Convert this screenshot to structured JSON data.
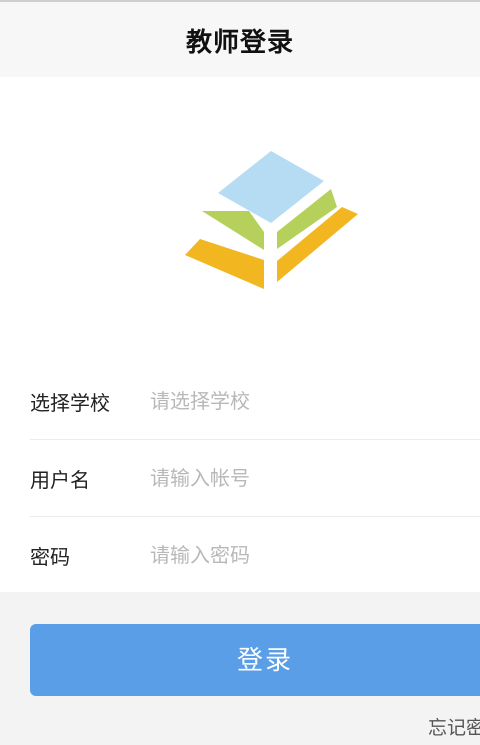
{
  "header": {
    "title": "教师登录"
  },
  "logo": {
    "name": "pyramid-logo",
    "colors": {
      "top": "#b6dcf3",
      "middle": "#b5d15b",
      "bottom": "#f2b720"
    }
  },
  "form": {
    "school": {
      "label": "选择学校",
      "placeholder": "请选择学校",
      "value": ""
    },
    "username": {
      "label": "用户名",
      "placeholder": "请输入帐号",
      "value": ""
    },
    "password": {
      "label": "密码",
      "placeholder": "请输入密码",
      "value": ""
    }
  },
  "login_button": {
    "label": "登录",
    "color": "#5b9ee8"
  },
  "forgot_password": {
    "label": "忘记密码"
  }
}
